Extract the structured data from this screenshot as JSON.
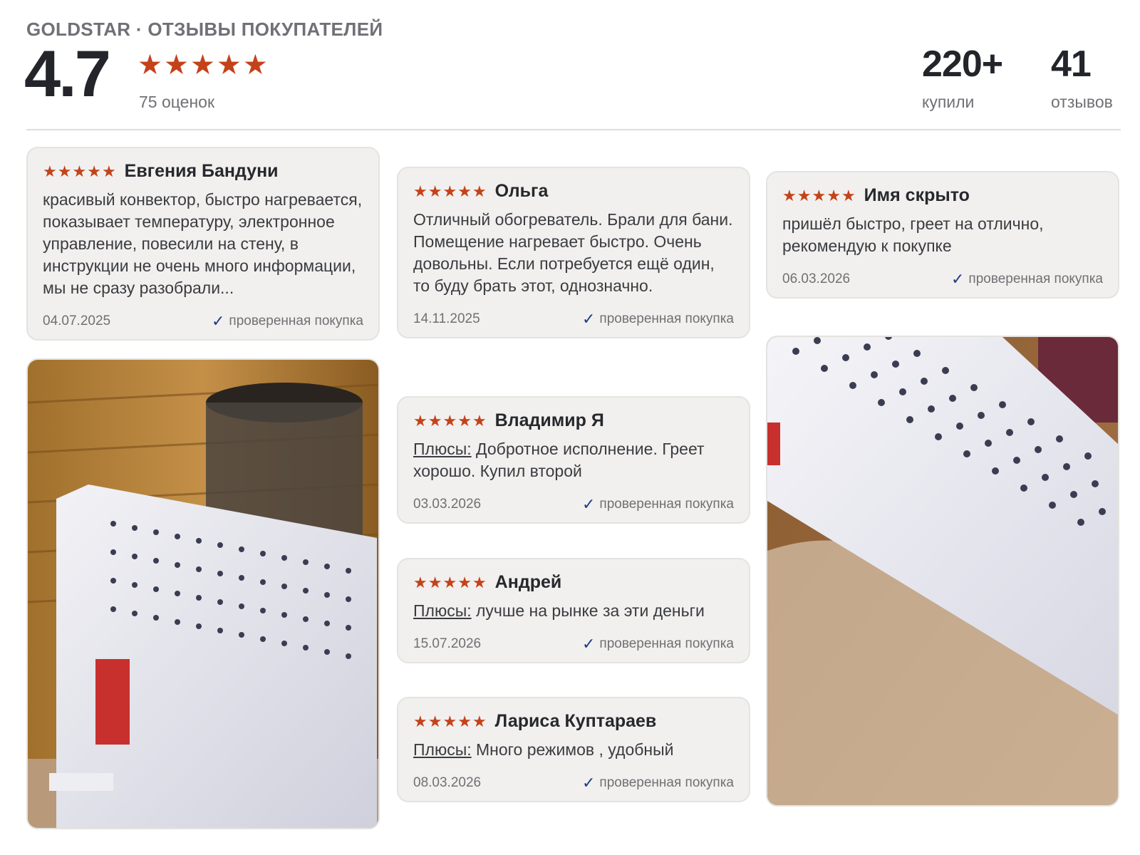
{
  "header": {
    "brand": "GOLDSTAR · ОТЗЫВЫ ПОКУПАТЕЛЕЙ",
    "score": "4.7",
    "stars": 5,
    "rating_count": "75 оценок",
    "bought_value": "220+",
    "bought_label": "купили",
    "reviews_value": "41",
    "reviews_label": "отзывов"
  },
  "verified_label": "проверенная покупка",
  "plus_label": "Плюсы:",
  "reviews": [
    {
      "name": "Евгения Бандуни",
      "stars": 5,
      "text": "красивый конвектор, быстро нагревается, показывает температуру, электронное управление, повесили на стену, в инструкции не очень много информации, мы не сразу разобрали...",
      "date": "04.07.2025"
    },
    {
      "name": "Ольга",
      "stars": 5,
      "text": "Отличный обогреватель. Брали для бани. Помещение нагревает быстро. Очень довольны. Если потребуется ещё один, то буду брать этот, однозначно.",
      "date": "14.11.2025"
    },
    {
      "name": "Имя скрыто",
      "stars": 5,
      "text": "пришёл быстро, греет на отлично, рекомендую к покупке",
      "date": "06.03.2026"
    },
    {
      "name": "Владимир Я",
      "stars": 5,
      "text": "Добротное исполнение. Греет хорошо. Купил второй",
      "date": "03.03.2026"
    },
    {
      "name": "Андрей",
      "stars": 5,
      "text": "лучше на рынке за эти деньги",
      "date": "15.07.2026"
    },
    {
      "name": "Лариса Куптараев",
      "stars": 5,
      "text": "Много режимов , удобный",
      "date": "08.03.2026"
    }
  ],
  "colors": {
    "star": "#c4421a",
    "check": "#1f3c88",
    "card_bg": "#f1f0ee"
  },
  "icons": {
    "star": "star-icon",
    "check": "check-icon"
  }
}
